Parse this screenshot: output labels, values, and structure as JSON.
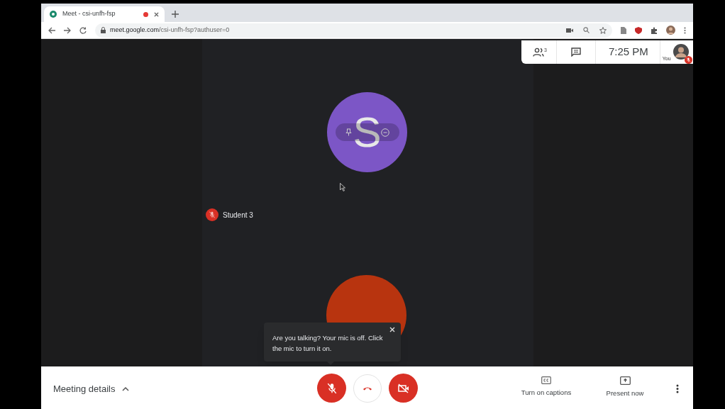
{
  "browser": {
    "tab": {
      "title": "Meet - csi-unfh-fsp",
      "recording": true
    },
    "url_host": "meet.google.com",
    "url_path": "/csi-unfh-fsp?authuser=0"
  },
  "top_panel": {
    "participants_count": "3",
    "time": "7:25 PM",
    "self_label": "You",
    "self_muted": true
  },
  "tiles": [
    {
      "letter": "S",
      "color": "#7c56c6",
      "hover_controls": true
    },
    {
      "color": "#b8340f",
      "hover_controls": false
    }
  ],
  "participant_label": {
    "name": "Student 3",
    "muted": true
  },
  "tooltip": {
    "text": "Are you talking? Your mic is off. Click the mic to turn it on."
  },
  "bottom_bar": {
    "meeting_details": "Meeting details",
    "mic_on": false,
    "camera_on": false,
    "actions": [
      {
        "kind": "captions",
        "label": "Turn on captions"
      },
      {
        "kind": "present",
        "label": "Present now"
      }
    ]
  }
}
